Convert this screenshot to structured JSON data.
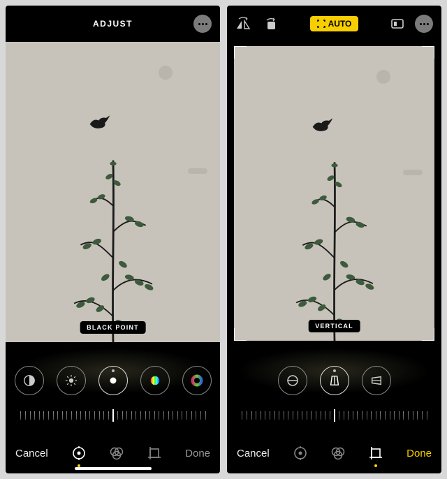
{
  "left": {
    "title": "ADJUST",
    "badge": "BLACK POINT",
    "dials": [
      "contrast",
      "brightness",
      "black-point",
      "saturation",
      "vibrance"
    ],
    "active_dial_index": 2,
    "bottom": {
      "cancel": "Cancel",
      "done": "Done"
    },
    "modes": [
      "adjust",
      "filters",
      "crop"
    ],
    "active_mode_index": 0
  },
  "right": {
    "auto_label": "AUTO",
    "badge": "VERTICAL",
    "dials": [
      "straighten",
      "vertical",
      "horizontal"
    ],
    "active_dial_index": 1,
    "bottom": {
      "cancel": "Cancel",
      "done": "Done"
    },
    "modes": [
      "adjust",
      "filters",
      "crop"
    ],
    "active_mode_index": 2
  }
}
